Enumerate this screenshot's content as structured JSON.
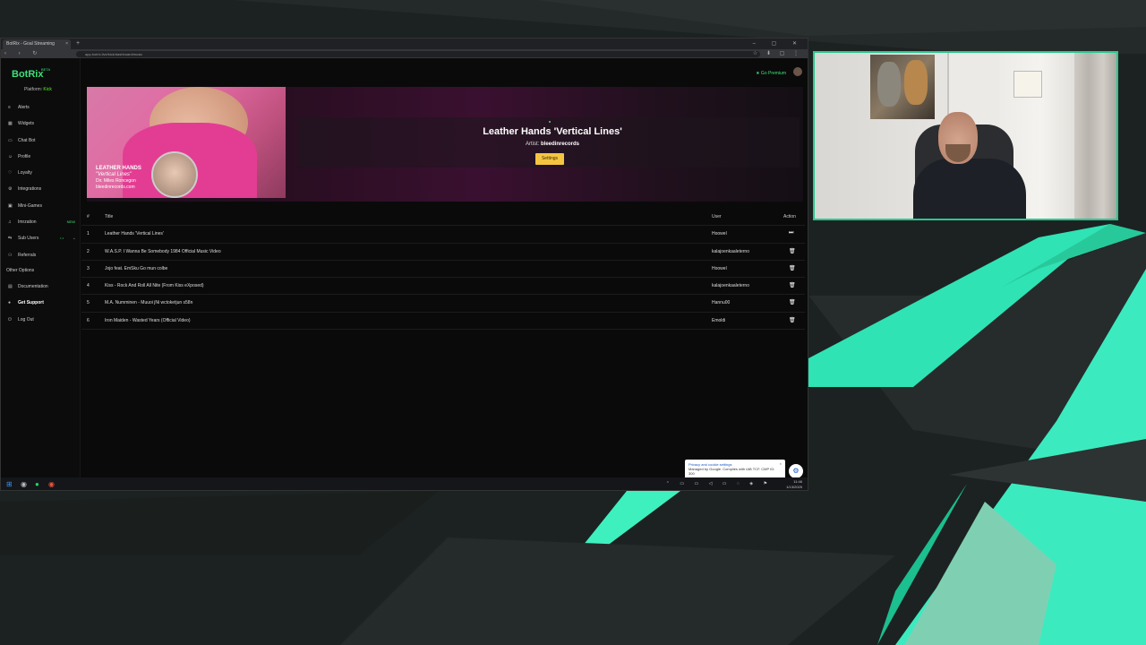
{
  "browser": {
    "tab_title": "BotRix - Goal Streaming",
    "tab_close": "×",
    "new_tab": "+",
    "window_controls": "– ▢ ✕",
    "nav_buttons": "‹ › ↻",
    "url": "app.botrix.live/kick/dashboard/music",
    "extensions": "☆ ⬇ ▢ ⋮"
  },
  "app": {
    "logo": "BotRix",
    "logo_badge": "BETA",
    "platform_label": "Platform:",
    "platform_value": "Kick",
    "go_premium": "★ Go Premium",
    "sidebar": {
      "items": [
        {
          "icon": "≡",
          "label": "Alerts"
        },
        {
          "icon": "▦",
          "label": "Widgets"
        },
        {
          "icon": "▭",
          "label": "Chat Bot"
        },
        {
          "icon": "☺",
          "label": "Profile"
        },
        {
          "icon": "♡",
          "label": "Loyalty"
        },
        {
          "icon": "⚙",
          "label": "Integrations"
        },
        {
          "icon": "▣",
          "label": "Mini-Games"
        },
        {
          "icon": "♫",
          "label": "Imrzation",
          "badge": "NEW"
        },
        {
          "icon": "⇆",
          "label": "Sub Users",
          "extra": "• •",
          "chevron": "⌄"
        },
        {
          "icon": "⚇",
          "label": "Referrals"
        }
      ],
      "other_options": "Other Options",
      "other_items": [
        {
          "icon": "▤",
          "label": "Documentation"
        },
        {
          "icon": "●",
          "label": "Get Support"
        },
        {
          "icon": "⏻",
          "label": "Log Out"
        }
      ]
    },
    "now_playing": {
      "title": "Leather Hands 'Vertical Lines'",
      "artist_label": "Artist:",
      "artist": "bleedinrecords",
      "settings_button": "Settings",
      "thumb_caption": [
        "LEATHER HANDS",
        "\"Vertical Lines\"",
        "Dir. Miles Roncegon",
        "bleedinrecords.com"
      ]
    },
    "queue": {
      "headers": {
        "num": "#",
        "title": "Title",
        "user": "User",
        "action": "Action"
      },
      "rows": [
        {
          "num": "1",
          "title": "Leather Hands 'Vertical Lines'",
          "user": "Hoowel",
          "action": "⏭"
        },
        {
          "num": "2",
          "title": "W.A.S.P. I Wanna Be Somebody 1984 Official Music Video",
          "user": "kalajoenkaaleterno",
          "action": "🗑"
        },
        {
          "num": "3",
          "title": "Jojo feat. EmSku Go mun colbe",
          "user": "Hoowel",
          "action": "🗑"
        },
        {
          "num": "4",
          "title": "Kiss - Rock And Roll All Nite (From Kiss eXposed)",
          "user": "kalajoenkaaleterno",
          "action": "🗑"
        },
        {
          "num": "5",
          "title": "M.A. Numminen - Muuoi jNi wctoketjun s58n",
          "user": "Hannu00",
          "action": "🗑"
        },
        {
          "num": "6",
          "title": "Iron Maiden - Wasted Years (Official Video)",
          "user": "Emoldi",
          "action": "🗑"
        }
      ]
    },
    "cookie_toast": {
      "title": "Privacy and cookie settings",
      "body": "Managed by Google. Complies with IAB TCF. CMP ID: 300",
      "close": "×",
      "button": "⚙"
    }
  },
  "taskbar": {
    "icons": [
      "⊞",
      "◉",
      "●",
      "◉"
    ],
    "tray": "⌃ ▭ ▭ ◁ ▭ ◌ ◈ ⚑",
    "time": "11:46",
    "date": "1/13/2025"
  }
}
